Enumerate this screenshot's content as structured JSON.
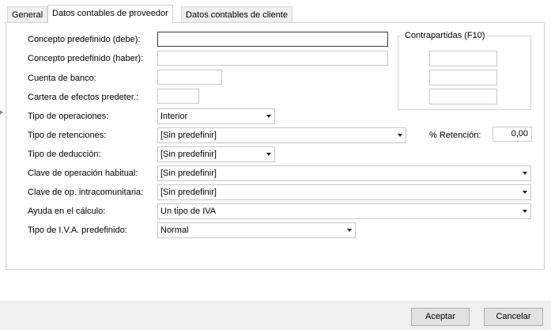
{
  "tabs": [
    {
      "label": "General",
      "active": false
    },
    {
      "label": "Datos contables de proveedor",
      "active": true
    },
    {
      "label": "Datos contables de cliente",
      "active": false
    }
  ],
  "form": {
    "concepto_debe": {
      "label": "Concepto predefinido (debe):",
      "value": ""
    },
    "concepto_haber": {
      "label": "Concepto predefinido (haber):",
      "value": ""
    },
    "cuenta_banco": {
      "label": "Cuenta de banco:",
      "value": ""
    },
    "cartera_efectos": {
      "label": "Cartera de efectos predeter.:",
      "value": ""
    },
    "tipo_operaciones": {
      "label": "Tipo de operaciones:",
      "value": "Interior"
    },
    "tipo_retenciones": {
      "label": "Tipo de retenciones:",
      "value": "[Sin predefinir]"
    },
    "retencion": {
      "label": "% Retención:",
      "value": "0,00"
    },
    "tipo_deduccion": {
      "label": "Tipo de deducción:",
      "value": "[Sin predefinir]"
    },
    "clave_operacion": {
      "label": "Clave de operación habitual:",
      "value": "[Sin predefinir]"
    },
    "clave_intracomunitaria": {
      "label": "Clave de op. intracomunitaria:",
      "value": "[Sin predefinir]"
    },
    "ayuda_calculo": {
      "label": "Ayuda en el cálculo:",
      "value": "Un tipo de IVA"
    },
    "tipo_iva": {
      "label": "Tipo de I.V.A. predefinido:",
      "value": "Normal"
    }
  },
  "contrapartidas": {
    "title": "Contrapartidas (F10)",
    "fields": [
      "",
      "",
      ""
    ]
  },
  "buttons": {
    "accept": "Aceptar",
    "cancel": "Cancelar"
  },
  "icons": {
    "dropdown": "chevron-down-icon",
    "side_marker": "chevron-right-icon"
  },
  "colors": {
    "footer_bg": "#f0f0f0",
    "border": "#c8c8c8",
    "focus_border": "#3c3c3c"
  }
}
